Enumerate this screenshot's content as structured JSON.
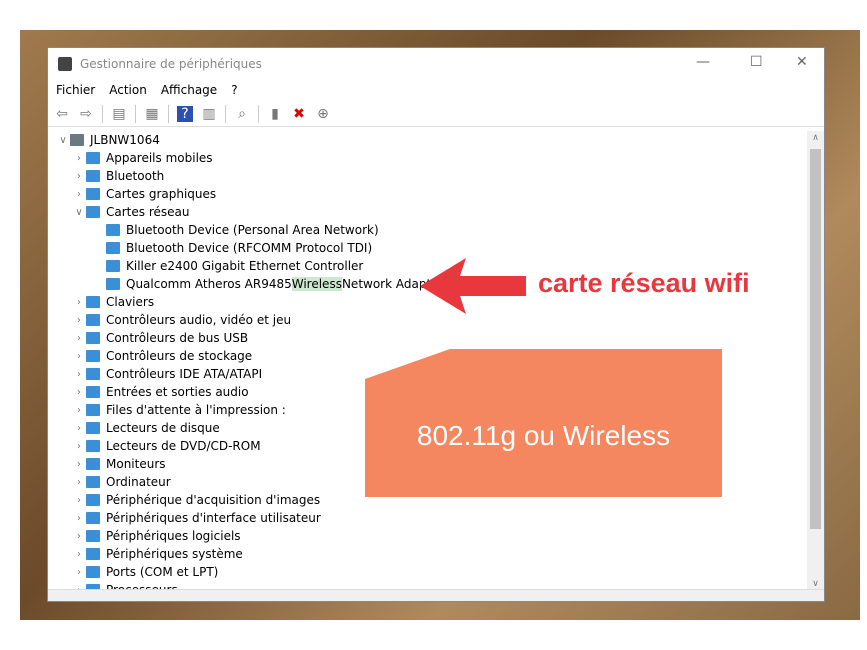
{
  "window": {
    "title": "Gestionnaire de périphériques",
    "minimize": "—",
    "maximize": "☐",
    "close": "✕"
  },
  "menu": [
    "Fichier",
    "Action",
    "Affichage",
    "?"
  ],
  "toolbar": [
    {
      "icon": "back-arrow-icon",
      "glyph": "⇦"
    },
    {
      "icon": "forward-arrow-icon",
      "glyph": "⇨"
    },
    {
      "icon": "show-hide-console-tree-icon",
      "glyph": "▤"
    },
    {
      "icon": "properties-icon",
      "glyph": "▦"
    },
    {
      "icon": "help-icon",
      "glyph": "?"
    },
    {
      "icon": "action-pane-icon",
      "glyph": "▥"
    },
    {
      "icon": "scan-hardware-icon",
      "glyph": "⌕"
    },
    {
      "icon": "update-driver-icon",
      "glyph": "▮"
    },
    {
      "icon": "uninstall-icon",
      "glyph": "✖"
    },
    {
      "icon": "download-icon",
      "glyph": "⊕"
    }
  ],
  "tree": {
    "root": "JLBNW1064",
    "items": [
      {
        "label": "Appareils mobiles",
        "level": 1,
        "expanded": false
      },
      {
        "label": "Bluetooth",
        "level": 1,
        "expanded": false
      },
      {
        "label": "Cartes graphiques",
        "level": 1,
        "expanded": false
      },
      {
        "label": "Cartes réseau",
        "level": 1,
        "expanded": true
      },
      {
        "label": "Bluetooth Device (Personal Area Network)",
        "level": 2
      },
      {
        "label": "Bluetooth Device (RFCOMM Protocol TDI)",
        "level": 2
      },
      {
        "label": "Killer e2400 Gigabit Ethernet Controller",
        "level": 2
      },
      {
        "label": "Qualcomm Atheros AR9485 ",
        "highlight": "Wireless",
        "after": " Network Adapter",
        "level": 2
      },
      {
        "label": "Claviers",
        "level": 1
      },
      {
        "label": "Contrôleurs audio, vidéo et jeu",
        "level": 1
      },
      {
        "label": "Contrôleurs de bus USB",
        "level": 1
      },
      {
        "label": "Contrôleurs de stockage",
        "level": 1
      },
      {
        "label": "Contrôleurs IDE ATA/ATAPI",
        "level": 1
      },
      {
        "label": "Entrées et sorties audio",
        "level": 1
      },
      {
        "label": "Files d'attente à l'impression :",
        "level": 1
      },
      {
        "label": "Lecteurs de disque",
        "level": 1
      },
      {
        "label": "Lecteurs de DVD/CD-ROM",
        "level": 1
      },
      {
        "label": "Moniteurs",
        "level": 1
      },
      {
        "label": "Ordinateur",
        "level": 1
      },
      {
        "label": "Périphérique d'acquisition d'images",
        "level": 1
      },
      {
        "label": "Périphériques d'interface utilisateur",
        "level": 1
      },
      {
        "label": "Périphériques logiciels",
        "level": 1
      },
      {
        "label": "Périphériques système",
        "level": 1
      },
      {
        "label": "Ports (COM et LPT)",
        "level": 1
      },
      {
        "label": "Processeurs",
        "level": 1
      }
    ]
  },
  "annotations": {
    "arrow_label": "carte réseau wifi",
    "callout": "802.11g ou Wireless",
    "arrow_color": "#e8383d",
    "callout_color": "#f4875f"
  }
}
